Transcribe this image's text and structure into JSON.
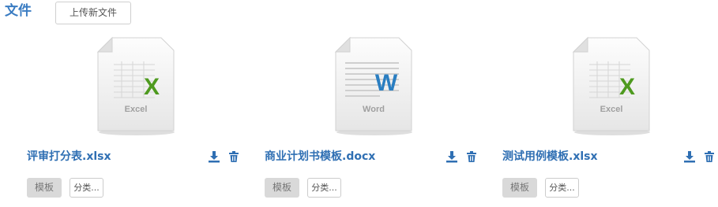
{
  "header": {
    "title": "文件",
    "upload_label": "上传新文件"
  },
  "files": [
    {
      "name": "评审打分表.xlsx",
      "type_label": "Excel",
      "type_letter": "X",
      "icon": "excel-file-icon",
      "tag_label": "模板",
      "category_label": "分类..."
    },
    {
      "name": "商业计划书模板.docx",
      "type_label": "Word",
      "type_letter": "W",
      "icon": "word-file-icon",
      "tag_label": "模板",
      "category_label": "分类..."
    },
    {
      "name": "测试用例模板.xlsx",
      "type_label": "Excel",
      "type_letter": "X",
      "icon": "excel-file-icon",
      "tag_label": "模板",
      "category_label": "分类..."
    }
  ],
  "colors": {
    "accent": "#3a7cc2",
    "excel_green": "#4e9a1f",
    "word_blue": "#2a7ec1"
  }
}
